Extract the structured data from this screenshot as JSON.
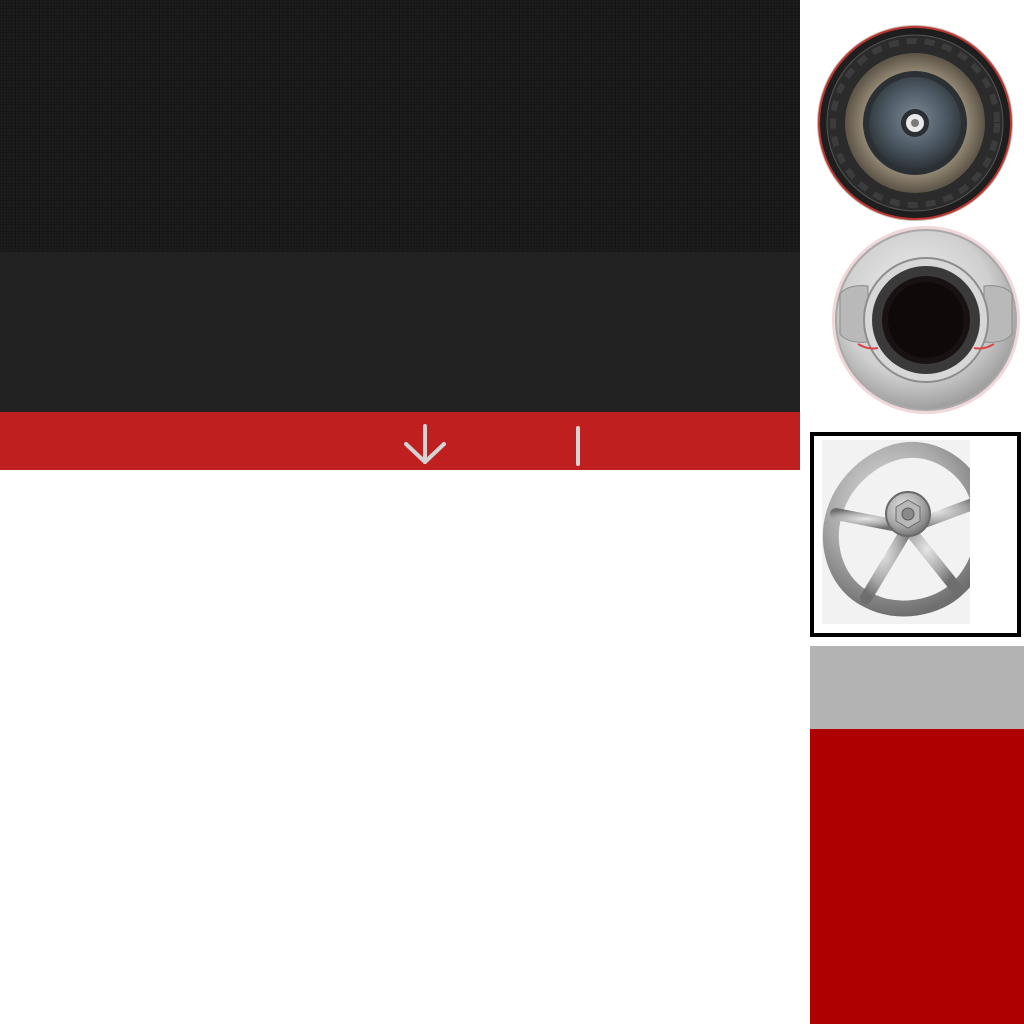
{
  "colors": {
    "dark_texture": "#181818",
    "mid_panel": "#222222",
    "red_band": "#bf1f1f",
    "band_icon": "#d4d4d4",
    "gray_swatch": "#b3b3b3",
    "red_swatch": "#ae0000",
    "frame_border": "#000000"
  },
  "icons": {
    "band_left": "arrow-down-icon",
    "band_right": "divider-icon",
    "sprite_1": "hose-coupling-icon",
    "sprite_2": "storz-coupling-icon",
    "sprite_3": "valve-handwheel-icon"
  }
}
